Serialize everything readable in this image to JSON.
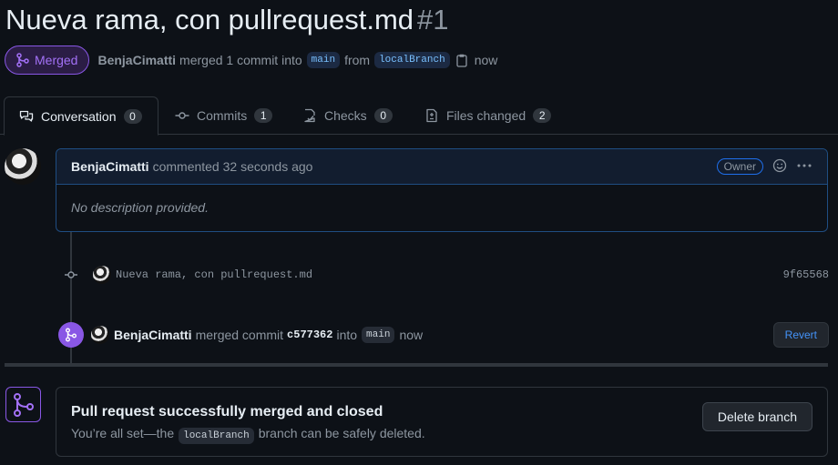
{
  "pr": {
    "title": "Nueva rama, con pullrequest.md",
    "number": "#1",
    "state": "Merged",
    "merged_by": "BenjaCimatti",
    "merge_text": "merged 1 commit into",
    "base_branch": "main",
    "from_text": "from",
    "head_branch": "localBranch",
    "time": "now"
  },
  "tabs": [
    {
      "label": "Conversation",
      "count": "0",
      "icon": "comment-discussion-icon"
    },
    {
      "label": "Commits",
      "count": "1",
      "icon": "git-commit-icon"
    },
    {
      "label": "Checks",
      "count": "0",
      "icon": "checklist-icon"
    },
    {
      "label": "Files changed",
      "count": "2",
      "icon": "file-diff-icon"
    }
  ],
  "comment": {
    "author": "BenjaCimatti",
    "action": "commented 32 seconds ago",
    "role": "Owner",
    "body": "No description provided."
  },
  "commit": {
    "message": "Nueva rama, con pullrequest.md",
    "sha": "9f65568"
  },
  "merge_event": {
    "author": "BenjaCimatti",
    "text1": "merged commit",
    "sha": "c577362",
    "text2": "into",
    "branch": "main",
    "time": "now",
    "revert_label": "Revert"
  },
  "merge_box": {
    "heading": "Pull request successfully merged and closed",
    "sub_prefix": "You’re all set—the",
    "branch": "localBranch",
    "sub_suffix": "branch can be safely deleted.",
    "delete_label": "Delete branch"
  },
  "colors": {
    "merged_purple": "#8957e5",
    "link_blue": "#4493f8",
    "background": "#0d1117"
  }
}
